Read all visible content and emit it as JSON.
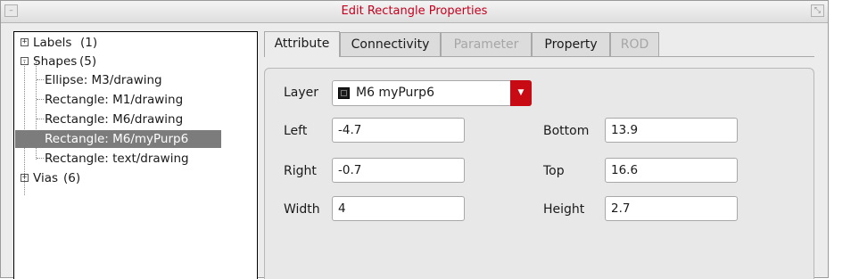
{
  "window": {
    "title": "Edit Rectangle Properties"
  },
  "tree": {
    "items": [
      {
        "label": "Labels",
        "count": "(1)",
        "expander": "+"
      },
      {
        "label": "Shapes",
        "count": "(5)",
        "expander": "-"
      },
      {
        "label": "Ellipse: M3/drawing"
      },
      {
        "label": "Rectangle: M1/drawing"
      },
      {
        "label": "Rectangle: M6/drawing"
      },
      {
        "label": "Rectangle: M6/myPurp6",
        "selected": true
      },
      {
        "label": "Rectangle: text/drawing"
      },
      {
        "label": "Vias",
        "count": "(6)",
        "expander": "+"
      }
    ]
  },
  "tabs": [
    {
      "label": "Attribute",
      "active": true
    },
    {
      "label": "Connectivity"
    },
    {
      "label": "Parameter",
      "disabled": true
    },
    {
      "label": "Property"
    },
    {
      "label": "ROD",
      "disabled": true
    }
  ],
  "form": {
    "layer_label": "Layer",
    "layer_value": "M6 myPurp6",
    "left_label": "Left",
    "left_value": "-4.7",
    "right_label": "Right",
    "right_value": "-0.7",
    "width_label": "Width",
    "width_value": "4",
    "bottom_label": "Bottom",
    "bottom_value": "13.9",
    "top_label": "Top",
    "top_value": "16.6",
    "height_label": "Height",
    "height_value": "2.7"
  },
  "colors": {
    "title": "#c4001e",
    "dropdown": "#c80a15",
    "selection": "#7c7c7c"
  }
}
